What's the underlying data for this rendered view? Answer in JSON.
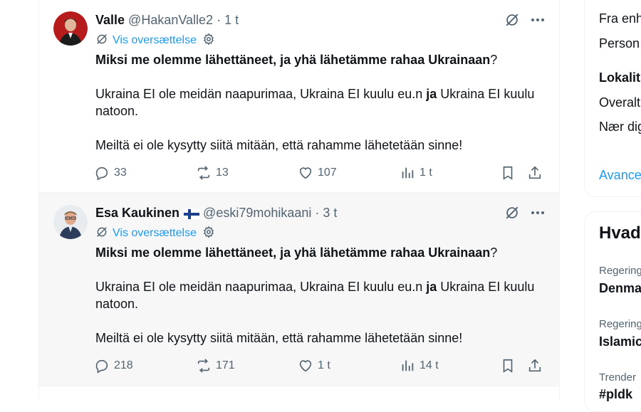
{
  "tweets": [
    {
      "name": "Valle",
      "flag": "",
      "handle": "@HakanValle2",
      "separator": "·",
      "time": "1 t",
      "translate_label": "Vis oversættelse",
      "body": {
        "p1_bold": "Miksi me olemme lähettäneet, ja yhä lähetämme rahaa Ukrainaan",
        "p1_end": "?",
        "p2_a": "Ukraina EI ole meidän naapurimaa, Ukraina EI kuulu eu.n ",
        "p2_bold": "ja",
        "p2_b": " Ukraina EI kuulu natoon.",
        "p3": "Meiltä ei ole kysytty siitä mitään, että rahamme lähetetään sinne!"
      },
      "stats": {
        "replies": "33",
        "reposts": "13",
        "likes": "107",
        "views": "1 t"
      }
    },
    {
      "name": "Esa Kaukinen",
      "flag": "finnish-flag",
      "handle": "@eski79mohikaani",
      "separator": "·",
      "time": "3 t",
      "translate_label": "Vis oversættelse",
      "body": {
        "p1_bold": "Miksi me olemme lähettäneet, ja yhä lähetämme rahaa Ukrainaan",
        "p1_end": "?",
        "p2_a": "Ukraina EI ole meidän naapurimaa, Ukraina EI kuulu eu.n ",
        "p2_bold": "ja",
        "p2_b": " Ukraina EI kuulu natoon.",
        "p3": "Meiltä ei ole kysytty siitä mitään, että rahamme lähetetään sinne!"
      },
      "stats": {
        "replies": "218",
        "reposts": "171",
        "likes": "1 t",
        "views": "14 t"
      }
    }
  ],
  "sidebar": {
    "card1": {
      "line1": "Fra enh",
      "line2": "Person",
      "heading": "Lokalit",
      "line3": "Overalt",
      "line4": "Nær dig",
      "link": "Avance"
    },
    "card2": {
      "title": "Hvad",
      "trends": [
        {
          "context": "Regering",
          "name": "Denma"
        },
        {
          "context": "Regering",
          "name": "Islamic"
        },
        {
          "context": "Trender",
          "name": "#pldk"
        }
      ]
    }
  },
  "colors": {
    "accent": "#1d9bf0",
    "secondary_text": "#536471",
    "text": "#0f1419"
  }
}
